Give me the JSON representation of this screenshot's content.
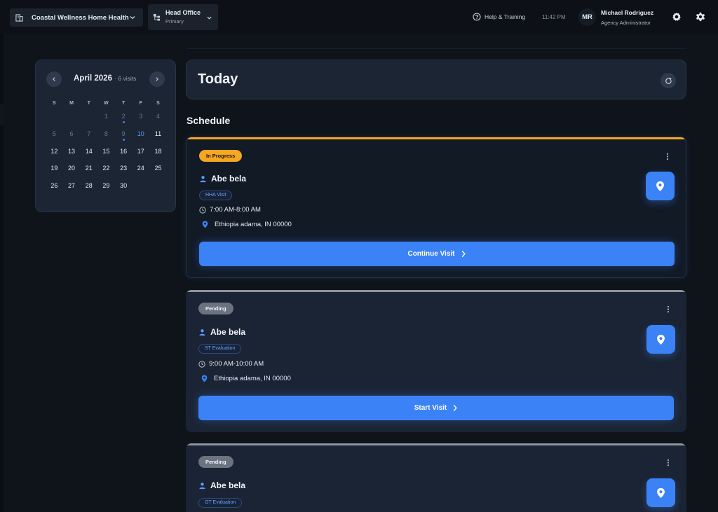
{
  "header": {
    "organization": "Coastal Wellness Home Health",
    "office_title": "Head Office",
    "office_subtitle": "Primary",
    "help_label": "Help & Training",
    "clock": "11:42 PM",
    "user_initials": "MR",
    "user_name": "Michael Rodriguez",
    "user_role": "Agency Administrator"
  },
  "calendar": {
    "month": "April 2026",
    "visits_label": "· 6 visits",
    "weekdays": [
      "S",
      "M",
      "T",
      "W",
      "T",
      "F",
      "S"
    ],
    "weeks": [
      [
        {
          "d": ""
        },
        {
          "d": ""
        },
        {
          "d": ""
        },
        {
          "d": "1",
          "dim": true
        },
        {
          "d": "2",
          "dim": true,
          "dot": true
        },
        {
          "d": "3",
          "dim": true
        },
        {
          "d": "4",
          "dim": true
        }
      ],
      [
        {
          "d": "5",
          "dim": true
        },
        {
          "d": "6",
          "dim": true
        },
        {
          "d": "7",
          "dim": true
        },
        {
          "d": "8",
          "dim": true
        },
        {
          "d": "9",
          "dim": true,
          "dot": true
        },
        {
          "d": "10",
          "today": true
        },
        {
          "d": "11"
        }
      ],
      [
        {
          "d": "12"
        },
        {
          "d": "13"
        },
        {
          "d": "14"
        },
        {
          "d": "15"
        },
        {
          "d": "16"
        },
        {
          "d": "17"
        },
        {
          "d": "18"
        }
      ],
      [
        {
          "d": "19"
        },
        {
          "d": "20"
        },
        {
          "d": "21"
        },
        {
          "d": "22"
        },
        {
          "d": "23"
        },
        {
          "d": "24"
        },
        {
          "d": "25"
        }
      ],
      [
        {
          "d": "26"
        },
        {
          "d": "27"
        },
        {
          "d": "28"
        },
        {
          "d": "29"
        },
        {
          "d": "30"
        },
        {
          "d": ""
        },
        {
          "d": ""
        }
      ]
    ]
  },
  "main": {
    "today_title": "Today",
    "schedule_heading": "Schedule"
  },
  "visits": [
    {
      "status": "In Progress",
      "patient": "Abe bela",
      "visit_type": "HHA Visit",
      "time": "7:00 AM-8:00 AM",
      "address": "Ethiopia adama, IN 00000",
      "action": "Continue Visit"
    },
    {
      "status": "Pending",
      "patient": "Abe bela",
      "visit_type": "ST Evaluation",
      "time": "9:00 AM-10:00 AM",
      "address": "Ethiopia adama, IN 00000",
      "action": "Start Visit"
    },
    {
      "status": "Pending",
      "patient": "Abe bela",
      "visit_type": "OT Evaluation"
    }
  ],
  "colors": {
    "accent": "#3b82f6",
    "in_progress": "#f5a623",
    "pending": "#6b7280"
  }
}
